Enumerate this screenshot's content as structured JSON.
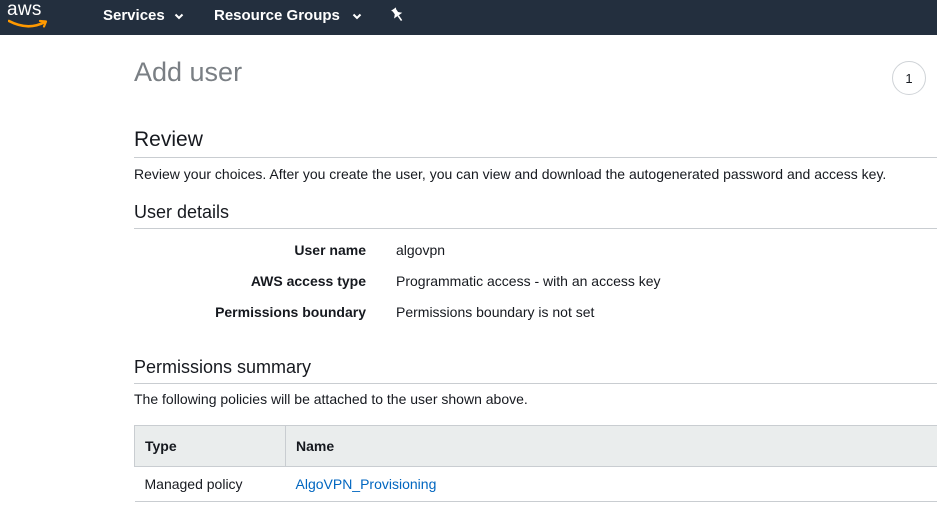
{
  "nav": {
    "logo_text": "aws",
    "services_label": "Services",
    "resource_groups_label": "Resource Groups",
    "pin_icon": "pin-icon"
  },
  "step": {
    "current": "1"
  },
  "page": {
    "title": "Add user"
  },
  "review": {
    "title": "Review",
    "description": "Review your choices. After you create the user, you can view and download the autogenerated password and access key."
  },
  "user_details": {
    "title": "User details",
    "rows": [
      {
        "label": "User name",
        "value": "algovpn"
      },
      {
        "label": "AWS access type",
        "value": "Programmatic access - with an access key"
      },
      {
        "label": "Permissions boundary",
        "value": "Permissions boundary is not set"
      }
    ]
  },
  "permissions": {
    "title": "Permissions summary",
    "description": "The following policies will be attached to the user shown above.",
    "columns": [
      "Type",
      "Name"
    ],
    "rows": [
      {
        "type": "Managed policy",
        "name": "AlgoVPN_Provisioning"
      }
    ]
  },
  "colors": {
    "nav_bg": "#232f3e",
    "link": "#0066c0",
    "aws_orange": "#ff9900"
  }
}
